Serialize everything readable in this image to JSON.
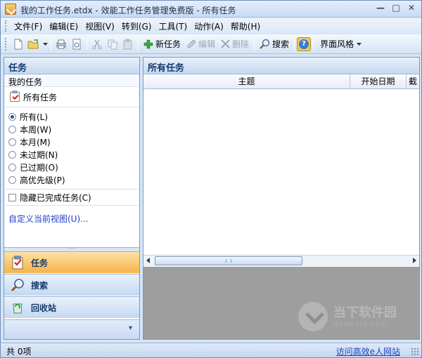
{
  "window": {
    "title": "我的工作任务.etdx - 效能工作任务管理免费版 - 所有任务",
    "min_glyph": "—",
    "max_glyph": "□",
    "close_glyph": "✕"
  },
  "menu": [
    {
      "label": "文件(F)"
    },
    {
      "label": "编辑(E)"
    },
    {
      "label": "视图(V)"
    },
    {
      "label": "转到(G)"
    },
    {
      "label": "工具(T)"
    },
    {
      "label": "动作(A)"
    },
    {
      "label": "帮助(H)"
    }
  ],
  "toolbar": {
    "new_task": "新任务",
    "edit": "编辑",
    "delete": "删除",
    "search": "搜索",
    "ui_style": "界面风格",
    "colors": {
      "add": "#2f9d2f",
      "delete": "#9aa7b8"
    }
  },
  "left_panel": {
    "title": "任务",
    "my_tasks": "我的任务",
    "all_tasks": "所有任务",
    "filters": [
      "所有(L)",
      "本周(W)",
      "本月(M)",
      "未过期(N)",
      "已过期(O)",
      "高优先级(P)"
    ],
    "selected_filter": "所有(L)",
    "hide_completed": "隐藏已完成任务(C)",
    "custom_view_link": "自定义当前视图(U)...",
    "nav": {
      "tasks": "任务",
      "search": "搜索",
      "recycle": "回收站",
      "more": "▾"
    }
  },
  "right_panel": {
    "title": "所有任务",
    "columns": [
      "主题",
      "开始日期",
      "截"
    ]
  },
  "watermark": {
    "text": "当下软件园",
    "sub": "downxia.com"
  },
  "status": {
    "count": "共 0项",
    "link": "访问高效e人网站"
  },
  "colors": {
    "accent": "#f7b24a",
    "panel_title": "#15396b",
    "link": "#1d3fc4",
    "preview_bg": "#9e9e9e"
  }
}
